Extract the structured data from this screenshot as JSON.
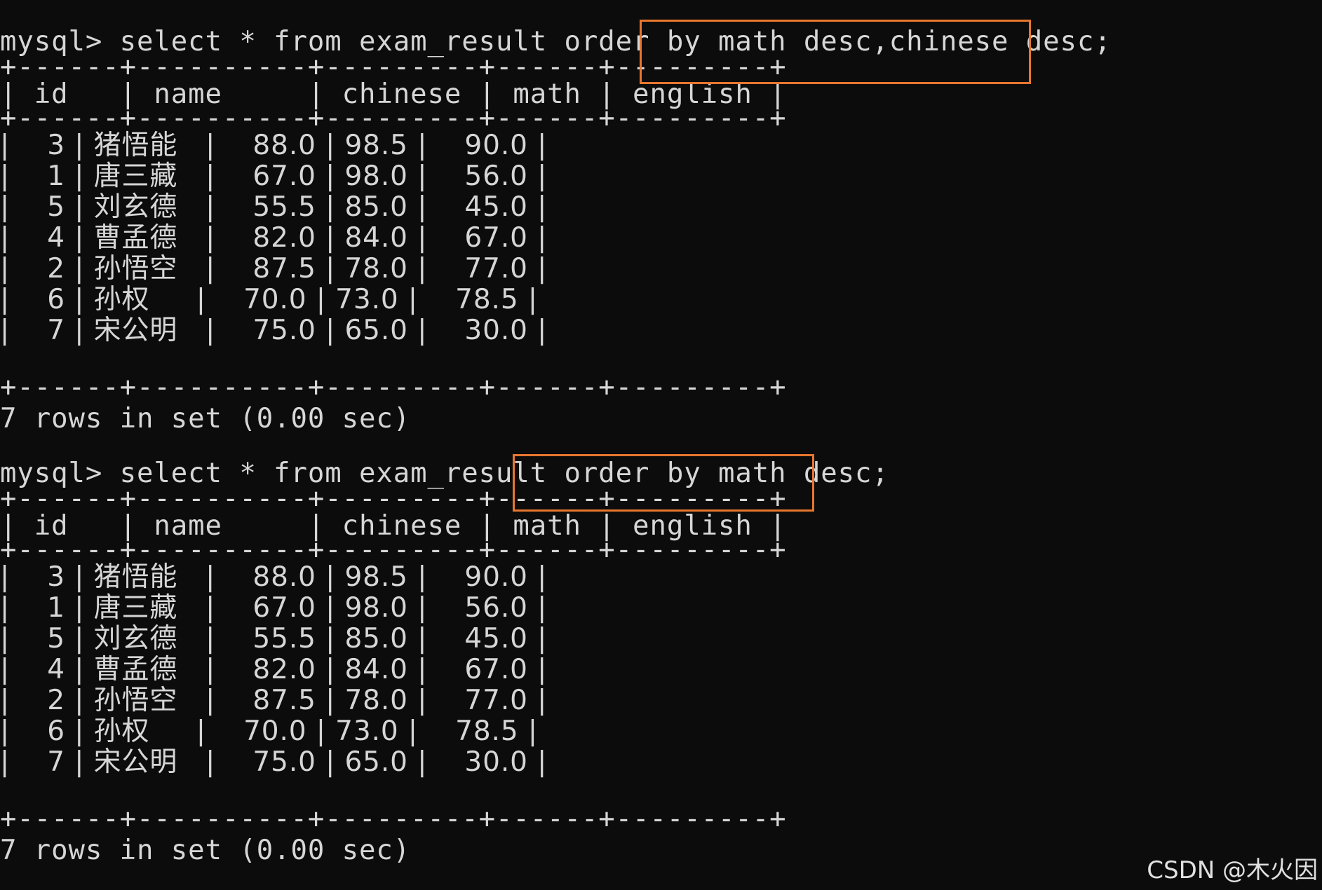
{
  "terminal": {
    "query1": {
      "prompt_line": "mysql> select * from exam_result order by math desc,chinese desc;",
      "border": "+------+----------+---------+------+---------+",
      "header": "| id   | name     | chinese | math | english |",
      "rows": [
        "|    3 | 猪悟能   |    88.0 | 98.5 |    90.0 |",
        "|    1 | 唐三藏   |    67.0 | 98.0 |    56.0 |",
        "|    5 | 刘玄德   |    55.5 | 85.0 |    45.0 |",
        "|    4 | 曹孟德   |    82.0 | 84.0 |    67.0 |",
        "|    2 | 孙悟空   |    87.5 | 78.0 |    77.0 |",
        "|    6 | 孙权     |    70.0 | 73.0 |    78.5 |",
        "|    7 | 宋公明   |    75.0 | 65.0 |    30.0 |"
      ],
      "status": "7 rows in set (0.00 sec)"
    },
    "query2": {
      "prompt_line": "mysql> select * from exam_result order by math desc;",
      "border": "+------+----------+---------+------+---------+",
      "header": "| id   | name     | chinese | math | english |",
      "rows": [
        "|    3 | 猪悟能   |    88.0 | 98.5 |    90.0 |",
        "|    1 | 唐三藏   |    67.0 | 98.0 |    56.0 |",
        "|    5 | 刘玄德   |    55.5 | 85.0 |    45.0 |",
        "|    4 | 曹孟德   |    82.0 | 84.0 |    67.0 |",
        "|    2 | 孙悟空   |    87.5 | 78.0 |    77.0 |",
        "|    6 | 孙权     |    70.0 | 73.0 |    78.5 |",
        "|    7 | 宋公明   |    75.0 | 65.0 |    30.0 |"
      ],
      "status": "7 rows in set (0.00 sec)"
    }
  },
  "watermark": "CSDN @木火因",
  "colors": {
    "background": "#0c0c0c",
    "text": "#d6d6d6",
    "highlight": "#e8772e"
  }
}
